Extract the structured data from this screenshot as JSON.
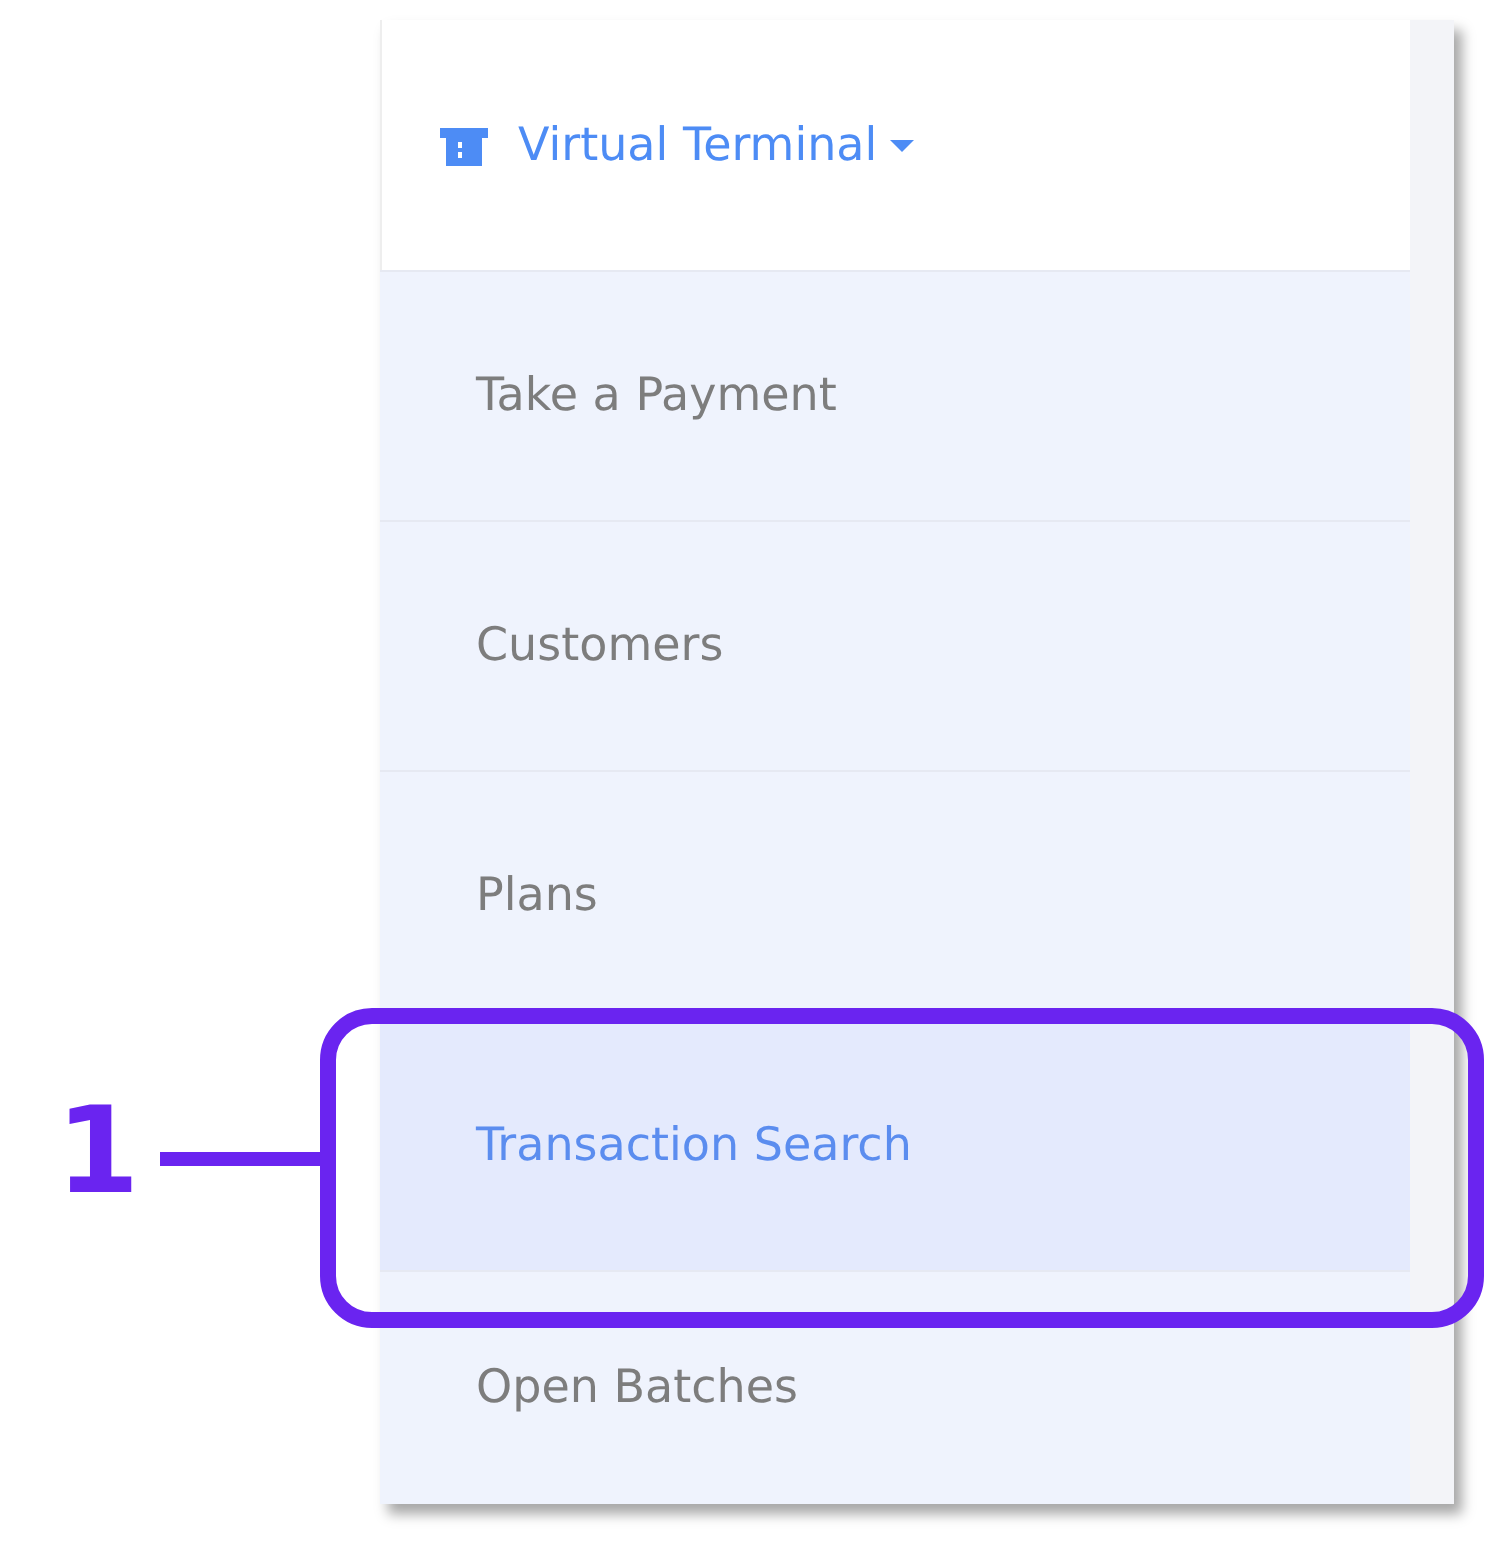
{
  "menu": {
    "header": {
      "label": "Virtual Terminal",
      "expanded": true
    },
    "items": [
      {
        "label": "Take a Payment",
        "selected": false
      },
      {
        "label": "Customers",
        "selected": false
      },
      {
        "label": "Plans",
        "selected": false
      },
      {
        "label": "Transaction Search",
        "selected": true
      },
      {
        "label": "Open Batches",
        "selected": false
      }
    ]
  },
  "callout": {
    "label": "1"
  }
}
